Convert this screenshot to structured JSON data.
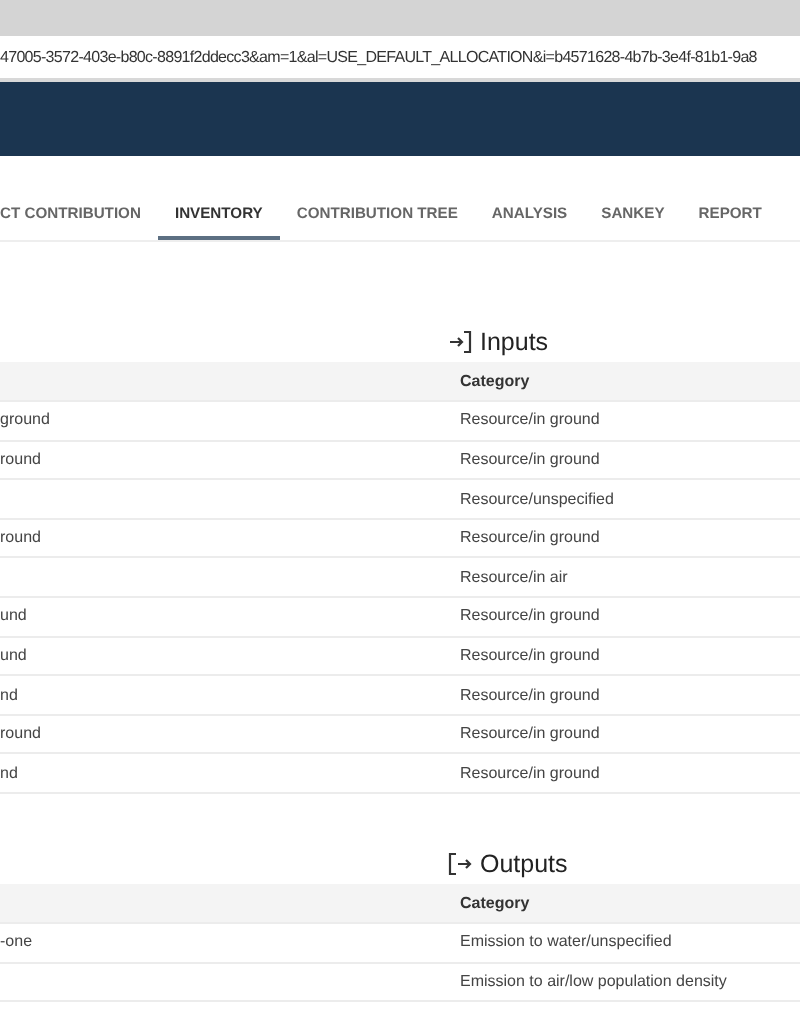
{
  "address_bar": {
    "url": "47005-3572-403e-b80c-8891f2ddecc3&am=1&al=USE_DEFAULT_ALLOCATION&i=b4571628-4b7b-3e4f-81b1-9a8"
  },
  "tabs": [
    {
      "label": "CT CONTRIBUTION",
      "selected": false
    },
    {
      "label": "INVENTORY",
      "selected": true
    },
    {
      "label": "CONTRIBUTION TREE",
      "selected": false
    },
    {
      "label": "ANALYSIS",
      "selected": false
    },
    {
      "label": "SANKEY",
      "selected": false
    },
    {
      "label": "REPORT",
      "selected": false
    }
  ],
  "sections": [
    {
      "kind": "inputs",
      "title": "Inputs",
      "columns": {
        "column_2": "Category"
      },
      "rows": [
        {
          "column_1": "ground",
          "category": "Resource/in ground"
        },
        {
          "column_1": "round",
          "category": "Resource/in ground"
        },
        {
          "category": "Resource/unspecified"
        },
        {
          "column_1": "round",
          "category": "Resource/in ground"
        },
        {
          "category": "Resource/in air"
        },
        {
          "column_1": "und",
          "category": "Resource/in ground"
        },
        {
          "column_1": "und",
          "category": "Resource/in ground"
        },
        {
          "column_1": "nd",
          "category": "Resource/in ground"
        },
        {
          "column_1": "round",
          "category": "Resource/in ground"
        },
        {
          "column_1": "nd",
          "category": "Resource/in ground"
        }
      ]
    },
    {
      "kind": "outputs",
      "title": "Outputs",
      "columns": {
        "column_2": "Category"
      },
      "rows": [
        {
          "column_1": "-one",
          "category": "Emission to water/unspecified"
        },
        {
          "category": "Emission to air/low population density"
        }
      ]
    }
  ]
}
